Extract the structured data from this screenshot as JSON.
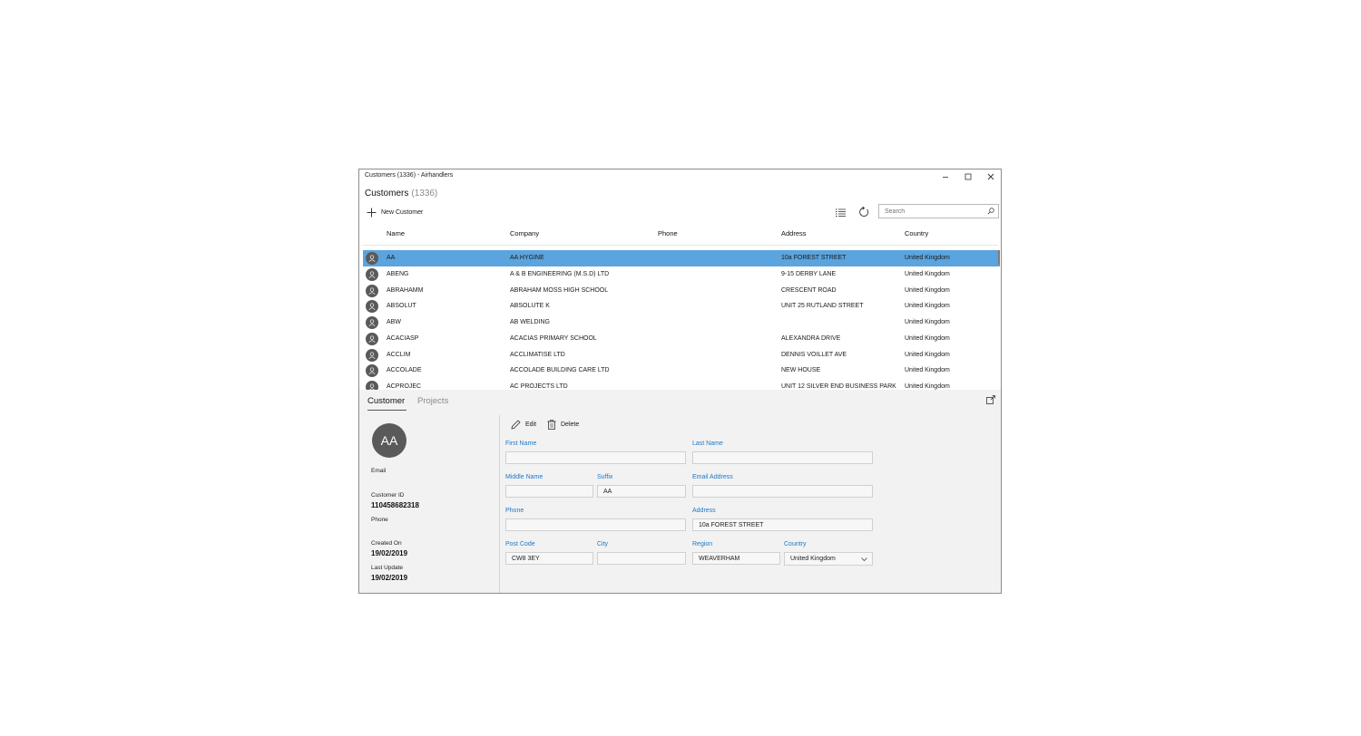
{
  "window": {
    "title": "Customers  (1336) - Airhandlers",
    "controls": {
      "minimize": "minimize-icon",
      "maximize": "maximize-icon",
      "close": "close-icon"
    }
  },
  "header": {
    "title": "Customers",
    "count": "(1336)",
    "new_label": "New Customer",
    "search_placeholder": "Search"
  },
  "columns": [
    "Name",
    "Company",
    "Phone",
    "Address",
    "Country"
  ],
  "rows": [
    {
      "name": "AA",
      "company": "AA HYGINE",
      "phone": "",
      "address": "10a FOREST STREET",
      "country": "United Kingdom",
      "selected": true
    },
    {
      "name": "ABENG",
      "company": "A & B ENGINEERING (M.S.D) LTD",
      "phone": "",
      "address": "9-15 DERBY LANE",
      "country": "United Kingdom"
    },
    {
      "name": "ABRAHAMM",
      "company": "ABRAHAM MOSS HIGH SCHOOL",
      "phone": "",
      "address": "CRESCENT ROAD",
      "country": "United Kingdom"
    },
    {
      "name": "ABSOLUT",
      "company": "ABSOLUTE K",
      "phone": "",
      "address": "UNIT 25 RUTLAND STREET",
      "country": "United Kingdom"
    },
    {
      "name": "ABW",
      "company": "AB WELDING",
      "phone": "",
      "address": "",
      "country": "United Kingdom"
    },
    {
      "name": "ACACIASP",
      "company": "ACACIAS PRIMARY SCHOOL",
      "phone": "",
      "address": "ALEXANDRA DRIVE",
      "country": "United Kingdom"
    },
    {
      "name": "ACCLIM",
      "company": "ACCLIMATISE LTD",
      "phone": "",
      "address": "DENNIS VOILLET AVE",
      "country": "United Kingdom"
    },
    {
      "name": "ACCOLADE",
      "company": "ACCOLADE BUILDING CARE LTD",
      "phone": "",
      "address": "NEW HOUSE",
      "country": "United Kingdom"
    },
    {
      "name": "ACPROJEC",
      "company": "AC PROJECTS LTD",
      "phone": "",
      "address": "UNIT 12 SILVER END BUSINESS PARK",
      "country": "United Kingdom"
    }
  ],
  "detail": {
    "tabs": [
      "Customer",
      "Projects"
    ],
    "active_tab": "Customer",
    "initials": "AA",
    "email_label": "Email",
    "email_value": "",
    "customer_id_label": "Customer ID",
    "customer_id": "110458682318",
    "phone_label": "Phone",
    "phone_value": "",
    "created_label": "Created On",
    "created_on": "19/02/2019",
    "updated_label": "Last Update",
    "last_update": "19/02/2019",
    "edit_label": "Edit",
    "delete_label": "Delete",
    "form": {
      "first_name_label": "First Name",
      "first_name": "",
      "last_name_label": "Last Name",
      "last_name": "",
      "middle_name_label": "Middle Name",
      "middle_name": "",
      "suffix_label": "Suffix",
      "suffix": "AA",
      "email_label": "Email Address",
      "email": "",
      "phone_label": "Phone",
      "phone": "",
      "address_label": "Address",
      "address": "10a FOREST STREET",
      "postcode_label": "Post Code",
      "postcode": "CW8 3EY",
      "city_label": "City",
      "city": "",
      "region_label": "Region",
      "region": "WEAVERHAM",
      "country_label": "Country",
      "country": "United Kingdom"
    }
  },
  "colors": {
    "selection": "#5ba4de",
    "accent_label": "#1e78c8",
    "avatar": "#5a5a5a",
    "panel": "#f2f2f2"
  }
}
